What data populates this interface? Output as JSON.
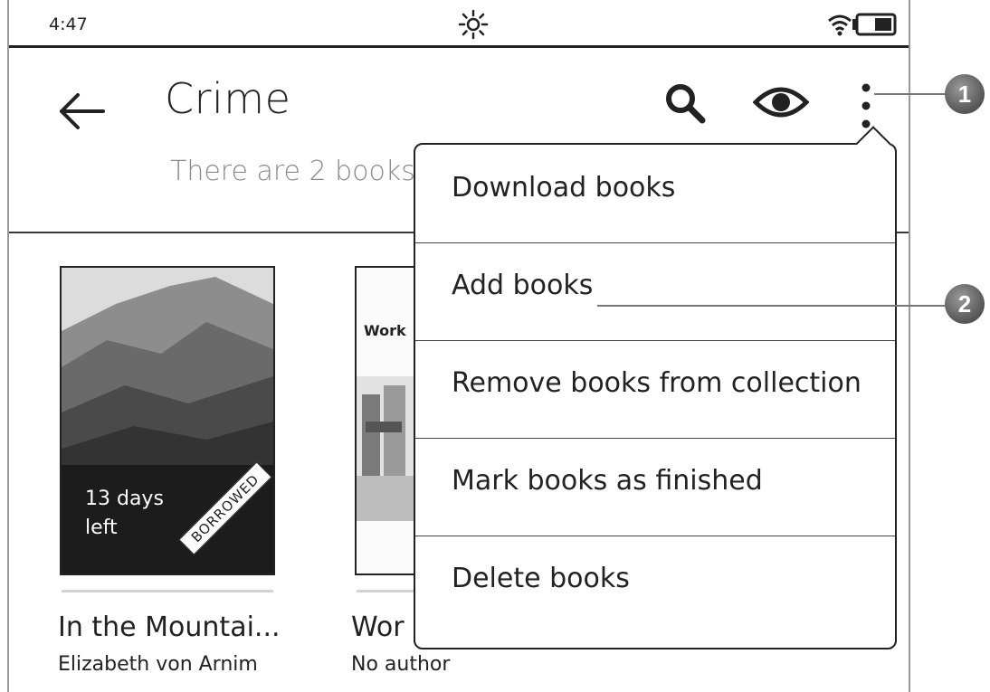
{
  "status": {
    "time": "4:47"
  },
  "header": {
    "title": "Crime",
    "book_count_text": "There are 2 books"
  },
  "books": [
    {
      "title": "In the Mountai...",
      "author": "Elizabeth von Arnim",
      "days_left_line1": "13 days",
      "days_left_line2": "left",
      "badge": "BORROWED"
    },
    {
      "title": "Wor",
      "author": "No author",
      "cover_text": "Work"
    }
  ],
  "menu": {
    "items": [
      {
        "label": "Download books"
      },
      {
        "label": "Add books"
      },
      {
        "label": "Remove books from collection"
      },
      {
        "label": "Mark books as finished"
      },
      {
        "label": "Delete books"
      }
    ]
  },
  "callouts": [
    {
      "number": "1"
    },
    {
      "number": "2"
    }
  ]
}
